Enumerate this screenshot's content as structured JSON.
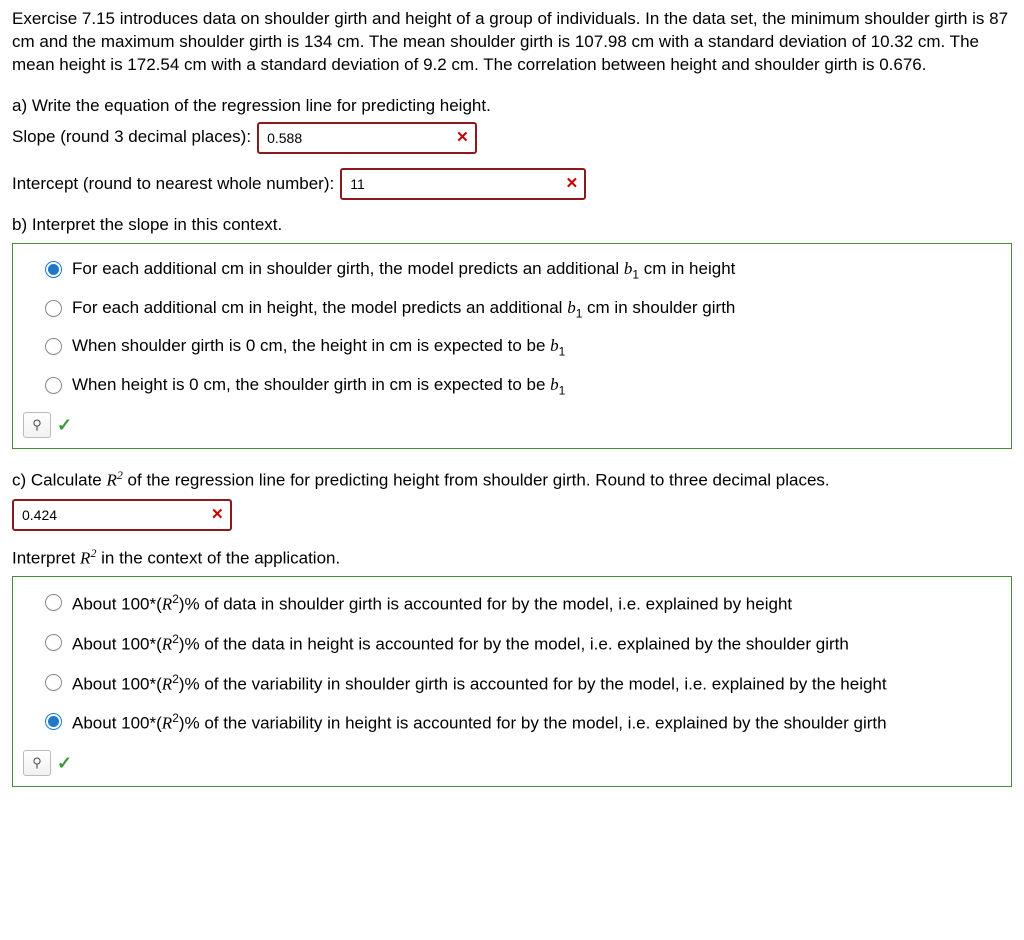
{
  "intro": "Exercise 7.15 introduces data on shoulder girth and height of a group of individuals. In the data set, the minimum shoulder girth is 87 cm and the maximum shoulder girth is 134 cm. The mean shoulder girth is 107.98 cm with a standard deviation of 10.32 cm. The mean height is 172.54 cm with a standard deviation of 9.2 cm. The correlation between height and shoulder girth is 0.676.",
  "partA": {
    "prompt": "a) Write the equation of the regression line for predicting height.",
    "slope_label": "Slope (round 3 decimal places):",
    "slope_value": "0.588",
    "intercept_label": "Intercept (round to nearest whole number):",
    "intercept_value": "11"
  },
  "partB": {
    "prompt": "b) Interpret the slope in this context.",
    "options": [
      {
        "pre": "For each additional cm in shoulder girth, the model predicts an additional ",
        "mathsym": "b",
        "mathsub": "1",
        "post": " cm in height",
        "selected": true
      },
      {
        "pre": "For each additional cm in height, the model predicts an additional ",
        "mathsym": "b",
        "mathsub": "1",
        "post": " cm in shoulder girth",
        "selected": false
      },
      {
        "pre": "When shoulder girth is 0 cm, the height in cm is expected to be ",
        "mathsym": "b",
        "mathsub": "1",
        "post": "",
        "selected": false
      },
      {
        "pre": "When height is 0 cm, the shoulder girth in cm is expected to be ",
        "mathsym": "b",
        "mathsub": "1",
        "post": "",
        "selected": false
      }
    ]
  },
  "partC": {
    "prompt_pre": "c) Calculate ",
    "prompt_math_base": "R",
    "prompt_math_sup": "2",
    "prompt_post": " of the regression line for predicting height from shoulder girth. Round to three decimal places.",
    "value": "0.424",
    "interpret_pre": "Interpret ",
    "interpret_post": " in the context of the application.",
    "options": [
      {
        "pre": "About 100*(",
        "post": ")% of data in shoulder girth is accounted for by the model, i.e. explained by height",
        "selected": false
      },
      {
        "pre": "About 100*(",
        "post": ")% of the data in height is accounted for by the model, i.e. explained by the shoulder girth",
        "selected": false
      },
      {
        "pre": "About 100*(",
        "post": ")% of the variability in shoulder girth is accounted for by the model, i.e. explained by the height",
        "selected": false
      },
      {
        "pre": "About 100*(",
        "post": ")% of the variability in height is accounted for by the model, i.e. explained by the shoulder girth",
        "selected": true
      }
    ]
  },
  "icons": {
    "x": "✕",
    "check": "✓",
    "tool": "⚲"
  }
}
